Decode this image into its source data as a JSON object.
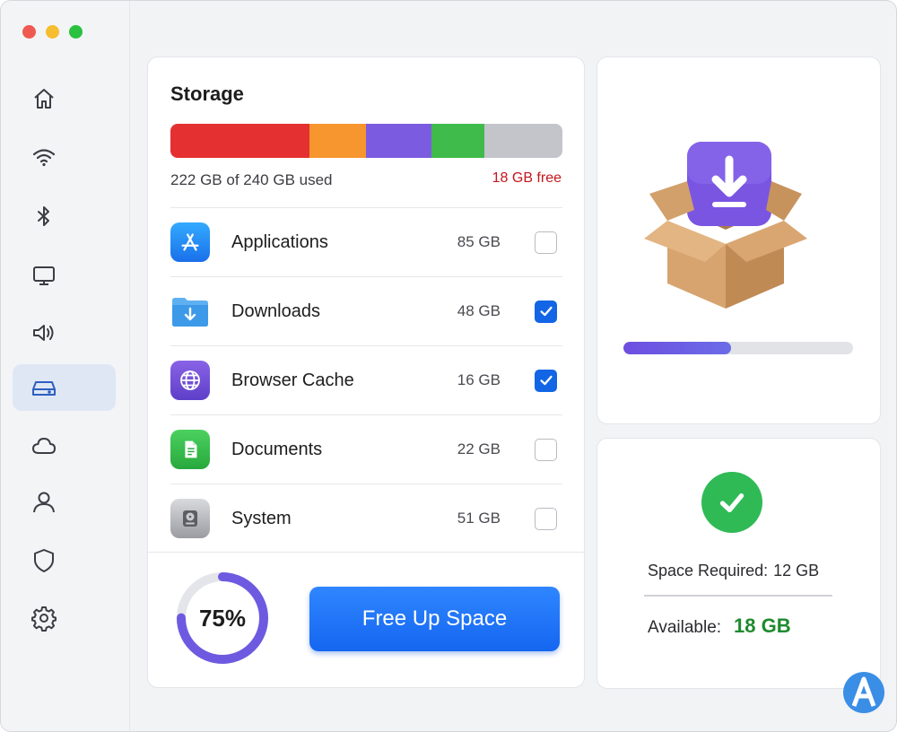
{
  "sidebar": {
    "items": [
      {
        "icon": "home-icon",
        "active": false
      },
      {
        "icon": "wifi-icon",
        "active": false
      },
      {
        "icon": "bluetooth-icon",
        "active": false
      },
      {
        "icon": "display-icon",
        "active": false
      },
      {
        "icon": "sound-icon",
        "active": false
      },
      {
        "icon": "storage-drive-icon",
        "active": true
      },
      {
        "icon": "cloud-icon",
        "active": false
      },
      {
        "icon": "user-icon",
        "active": false
      },
      {
        "icon": "shield-icon",
        "active": false
      },
      {
        "icon": "gear-icon",
        "active": false
      }
    ]
  },
  "storage": {
    "title": "Storage",
    "used_text": "222 GB of 240 GB used",
    "free_text": "18 GB free",
    "usage_segments": [
      {
        "color": "#e43030",
        "fraction": 0.354
      },
      {
        "color": "#f7962f",
        "fraction": 0.146
      },
      {
        "color": "#7b5be0",
        "fraction": 0.165
      },
      {
        "color": "#3fbb4c",
        "fraction": 0.135
      },
      {
        "color": "#c4c5ca",
        "fraction": 0.2
      }
    ],
    "items": [
      {
        "label": "Applications",
        "size": "85 GB",
        "checked": false,
        "icon": "app-store-icon"
      },
      {
        "label": "Downloads",
        "size": "48 GB",
        "checked": true,
        "icon": "downloads-folder-icon"
      },
      {
        "label": "Browser Cache",
        "size": "16 GB",
        "checked": true,
        "icon": "globe-icon"
      },
      {
        "label": "Documents",
        "size": "22 GB",
        "checked": false,
        "icon": "document-icon"
      },
      {
        "label": "System",
        "size": "51 GB",
        "checked": false,
        "icon": "hard-drive-icon"
      }
    ],
    "progress_percent": "75%",
    "progress_value": 0.75,
    "action_label": "Free Up Space"
  },
  "download": {
    "icon": "download-box-icon",
    "progress": 0.47
  },
  "summary": {
    "required_label": "Space Required:",
    "required_value": "12 GB",
    "available_label": "Available:",
    "available_value": "18 GB"
  },
  "colors": {
    "accent": "#1266e6",
    "success": "#2fba56",
    "warning_red": "#c4151c"
  }
}
